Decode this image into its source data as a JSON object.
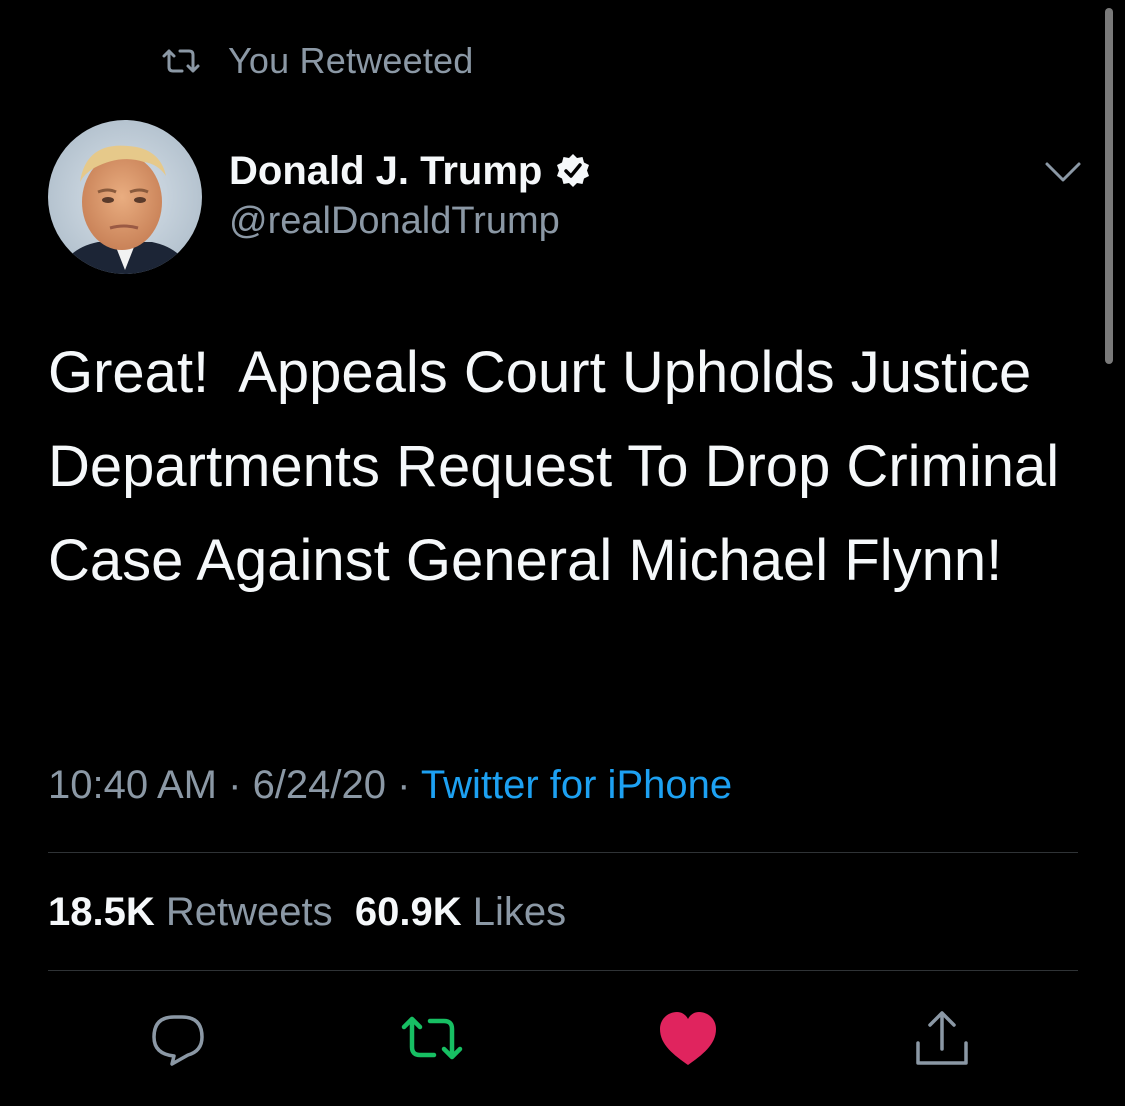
{
  "retweet_context": {
    "icon": "retweet-icon",
    "label": "You Retweeted"
  },
  "author": {
    "display_name": "Donald J. Trump",
    "verified_icon": "verified-badge-icon",
    "handle": "@realDonaldTrump"
  },
  "menu_icon": "chevron-down-icon",
  "tweet": {
    "text": "Great!  Appeals Court Upholds Justice Departments Request To Drop Criminal Case Against General Michael Flynn!"
  },
  "meta": {
    "time": "10:40 AM",
    "separator_1": " · ",
    "date": "6/24/20",
    "separator_2": " · ",
    "source": "Twitter for iPhone"
  },
  "stats": {
    "retweets_count": "18.5K",
    "retweets_label": "Retweets",
    "likes_count": "60.9K",
    "likes_label": "Likes"
  },
  "actions": {
    "reply_icon": "reply-icon",
    "retweet_icon": "retweet-icon",
    "like_icon": "heart-icon",
    "share_icon": "share-icon",
    "retweet_active_color": "#17bf63",
    "like_active_color": "#e0245e"
  },
  "colors": {
    "background": "#000000",
    "primary_text": "#f5f8fa",
    "secondary_text": "#8b98a5",
    "link": "#1da1f2",
    "divider": "#2f3336"
  }
}
